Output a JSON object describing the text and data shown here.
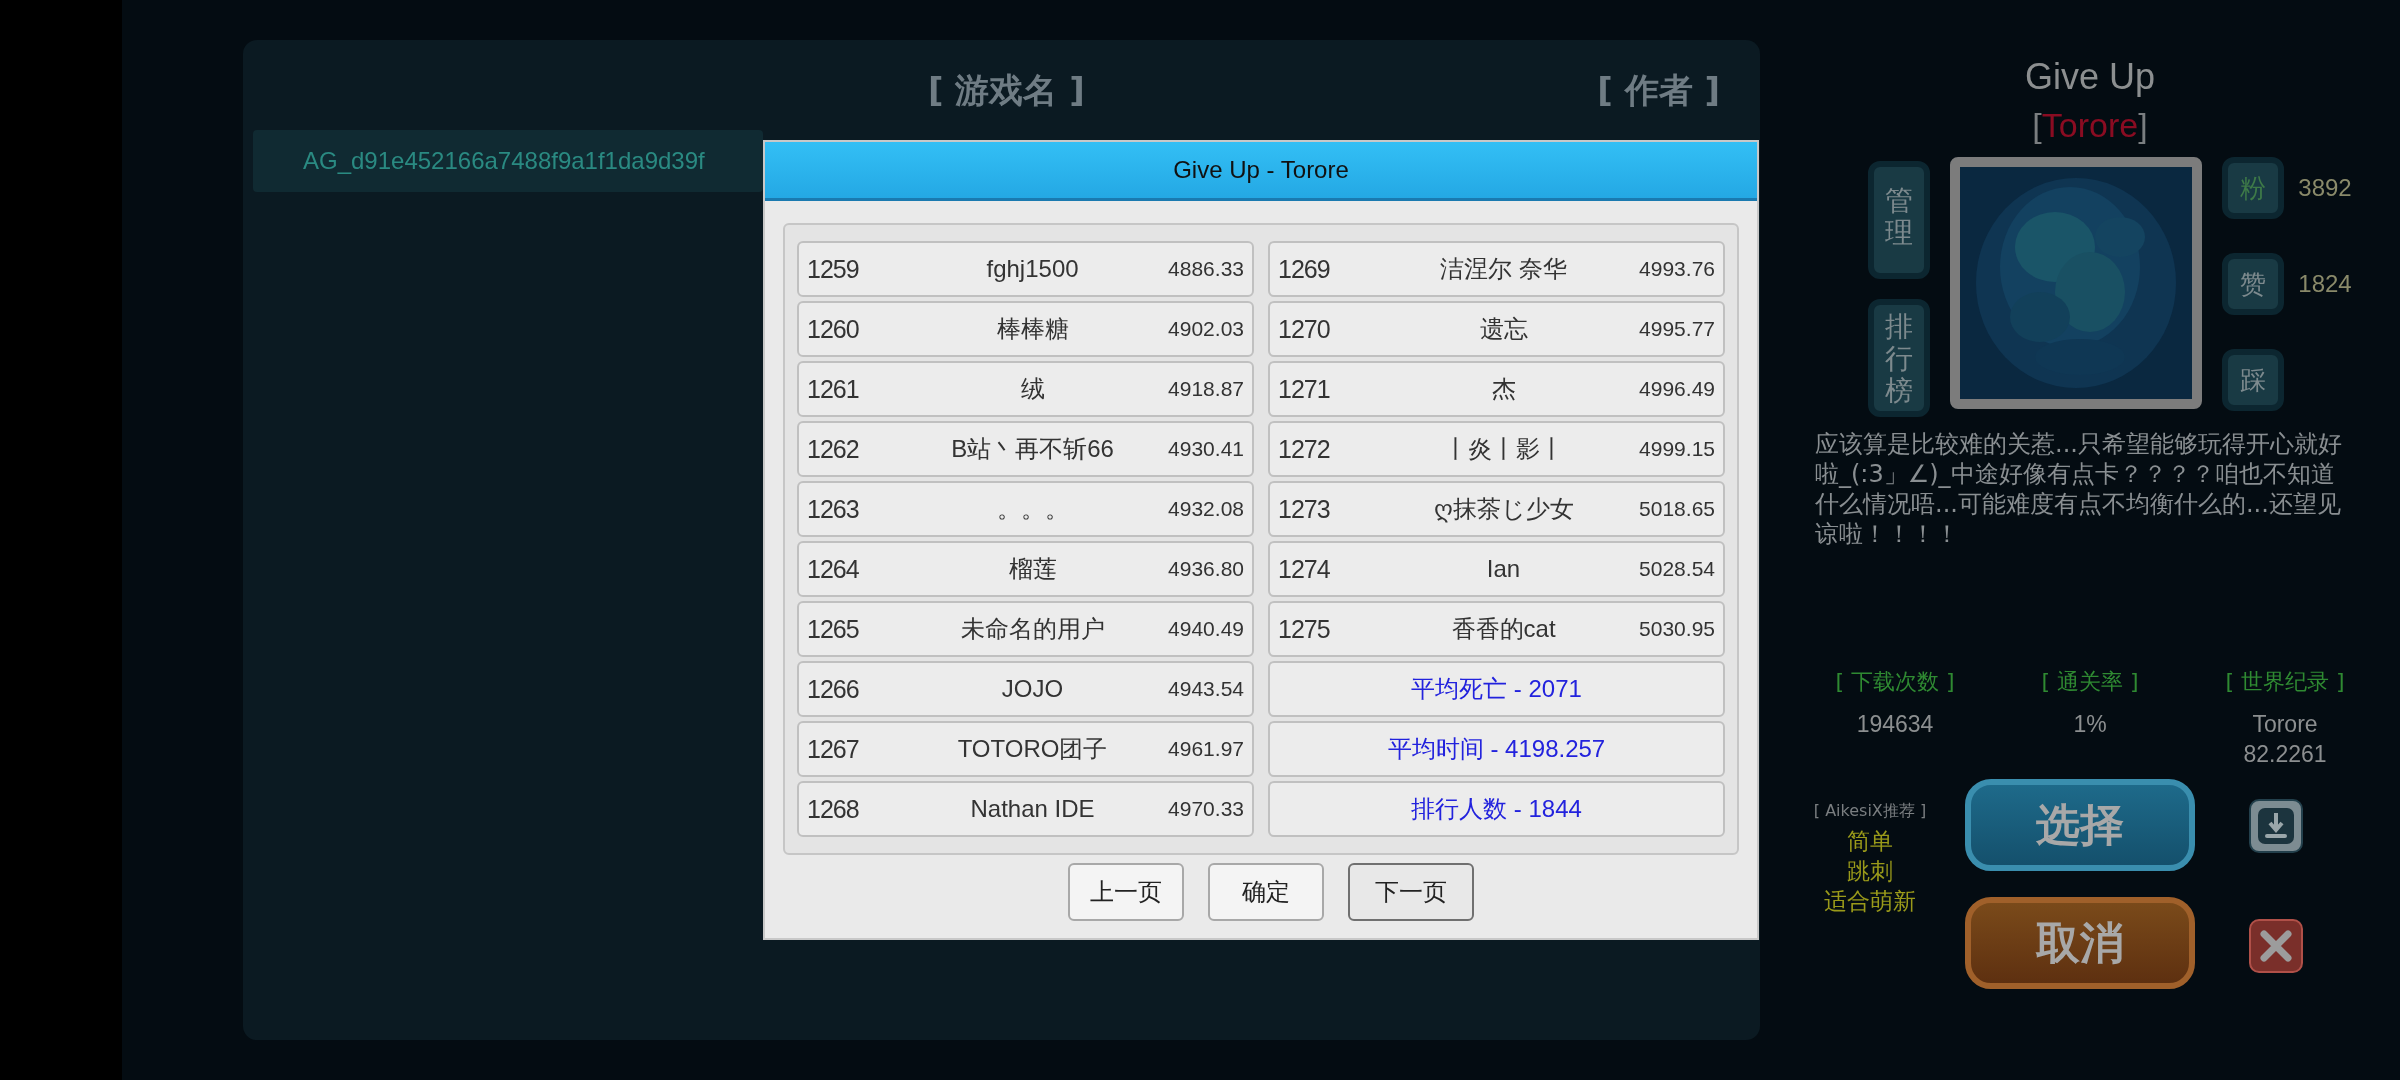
{
  "header": {
    "game_column": "[ 游戏名 ]",
    "author_column": "[ 作者 ]"
  },
  "game_list": [
    {
      "name": "AG_d91e452166a7488f9a1f1da9d39f"
    }
  ],
  "dialog": {
    "title": "Give Up - Torore",
    "entries": [
      {
        "rank": "1259",
        "name": "fghj1500",
        "time": "4886.33"
      },
      {
        "rank": "1260",
        "name": "棒棒糖",
        "time": "4902.03"
      },
      {
        "rank": "1261",
        "name": "绒",
        "time": "4918.87"
      },
      {
        "rank": "1262",
        "name": "B站丶再不斩66",
        "time": "4930.41"
      },
      {
        "rank": "1263",
        "name": "。。。",
        "time": "4932.08"
      },
      {
        "rank": "1264",
        "name": "榴莲",
        "time": "4936.80"
      },
      {
        "rank": "1265",
        "name": "未命名的用户",
        "time": "4940.49"
      },
      {
        "rank": "1266",
        "name": "JOJO",
        "time": "4943.54"
      },
      {
        "rank": "1267",
        "name": "TOTORO团子",
        "time": "4961.97"
      },
      {
        "rank": "1268",
        "name": "Nathan IDE",
        "time": "4970.33"
      },
      {
        "rank": "1269",
        "name": "洁涅尔 奈华",
        "time": "4993.76"
      },
      {
        "rank": "1270",
        "name": "遗忘",
        "time": "4995.77"
      },
      {
        "rank": "1271",
        "name": "杰",
        "time": "4996.49"
      },
      {
        "rank": "1272",
        "name": "丨炎丨影丨",
        "time": "4999.15"
      },
      {
        "rank": "1273",
        "name": "ღ抹茶じ少女",
        "time": "5018.65"
      },
      {
        "rank": "1274",
        "name": "Ian",
        "time": "5028.54"
      },
      {
        "rank": "1275",
        "name": "香香的cat",
        "time": "5030.95"
      }
    ],
    "summary": [
      "平均死亡 - 2071",
      "平均时间 - 4198.257",
      "排行人数 - 1844"
    ],
    "buttons": [
      "上一页",
      "确定",
      "下一页"
    ]
  },
  "detail": {
    "title": "Give Up",
    "bracket_open": "[",
    "author": "Torore",
    "bracket_close": "]",
    "side_buttons": [
      "管理",
      "排行榜"
    ],
    "counters": [
      {
        "label": "粉",
        "value": "3892",
        "active": true
      },
      {
        "label": "赞",
        "value": "1824",
        "active": false
      },
      {
        "label": "踩",
        "active": false
      }
    ],
    "description": "应该算是比较难的关惹...只希望能够玩得开心就好啦_(:3」∠)_中途好像有点卡？？？？咱也不知道什么情况唔...可能难度有点不均衡什么的...还望见谅啦！！！！",
    "stats": [
      {
        "label": "[ 下载次数 ]",
        "lines": [
          "194634"
        ]
      },
      {
        "label": "[ 通关率 ]",
        "lines": [
          "1%"
        ]
      },
      {
        "label": "[ 世界纪录 ]",
        "lines": [
          "Torore",
          "82.2261"
        ]
      }
    ],
    "recommend": {
      "label": "[ AikesiX推荐 ]",
      "tags": [
        "简单",
        "跳刺",
        "适合萌新"
      ]
    },
    "select_button": "选择",
    "cancel_button": "取消"
  }
}
